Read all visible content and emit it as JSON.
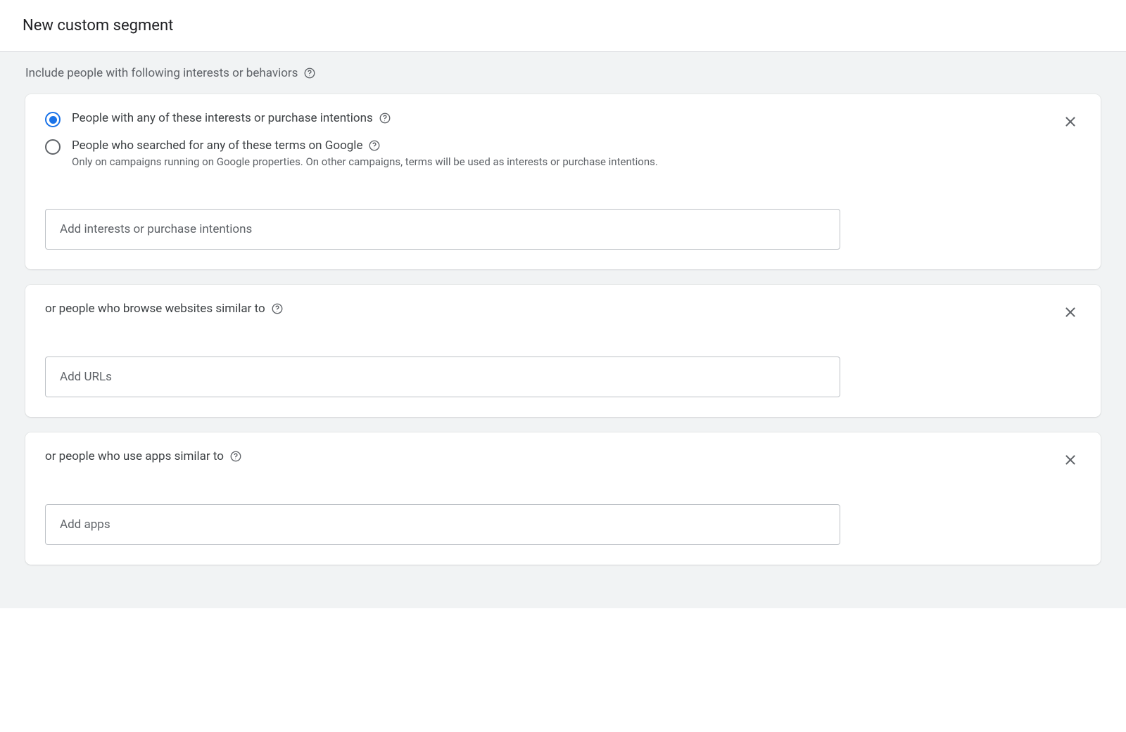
{
  "header": {
    "title": "New custom segment"
  },
  "intro": {
    "text": "Include people with following interests or behaviors"
  },
  "card_interests": {
    "radio_options": [
      {
        "label": "People with any of these interests or purchase intentions",
        "selected": true
      },
      {
        "label": "People who searched for any of these terms on Google",
        "helper": "Only on campaigns running on Google properties. On other campaigns, terms will be used as interests or purchase intentions.",
        "selected": false
      }
    ],
    "input_placeholder": "Add interests or purchase intentions"
  },
  "card_websites": {
    "title": "or people who browse websites similar to",
    "input_placeholder": "Add URLs"
  },
  "card_apps": {
    "title": "or people who use apps similar to",
    "input_placeholder": "Add apps"
  }
}
